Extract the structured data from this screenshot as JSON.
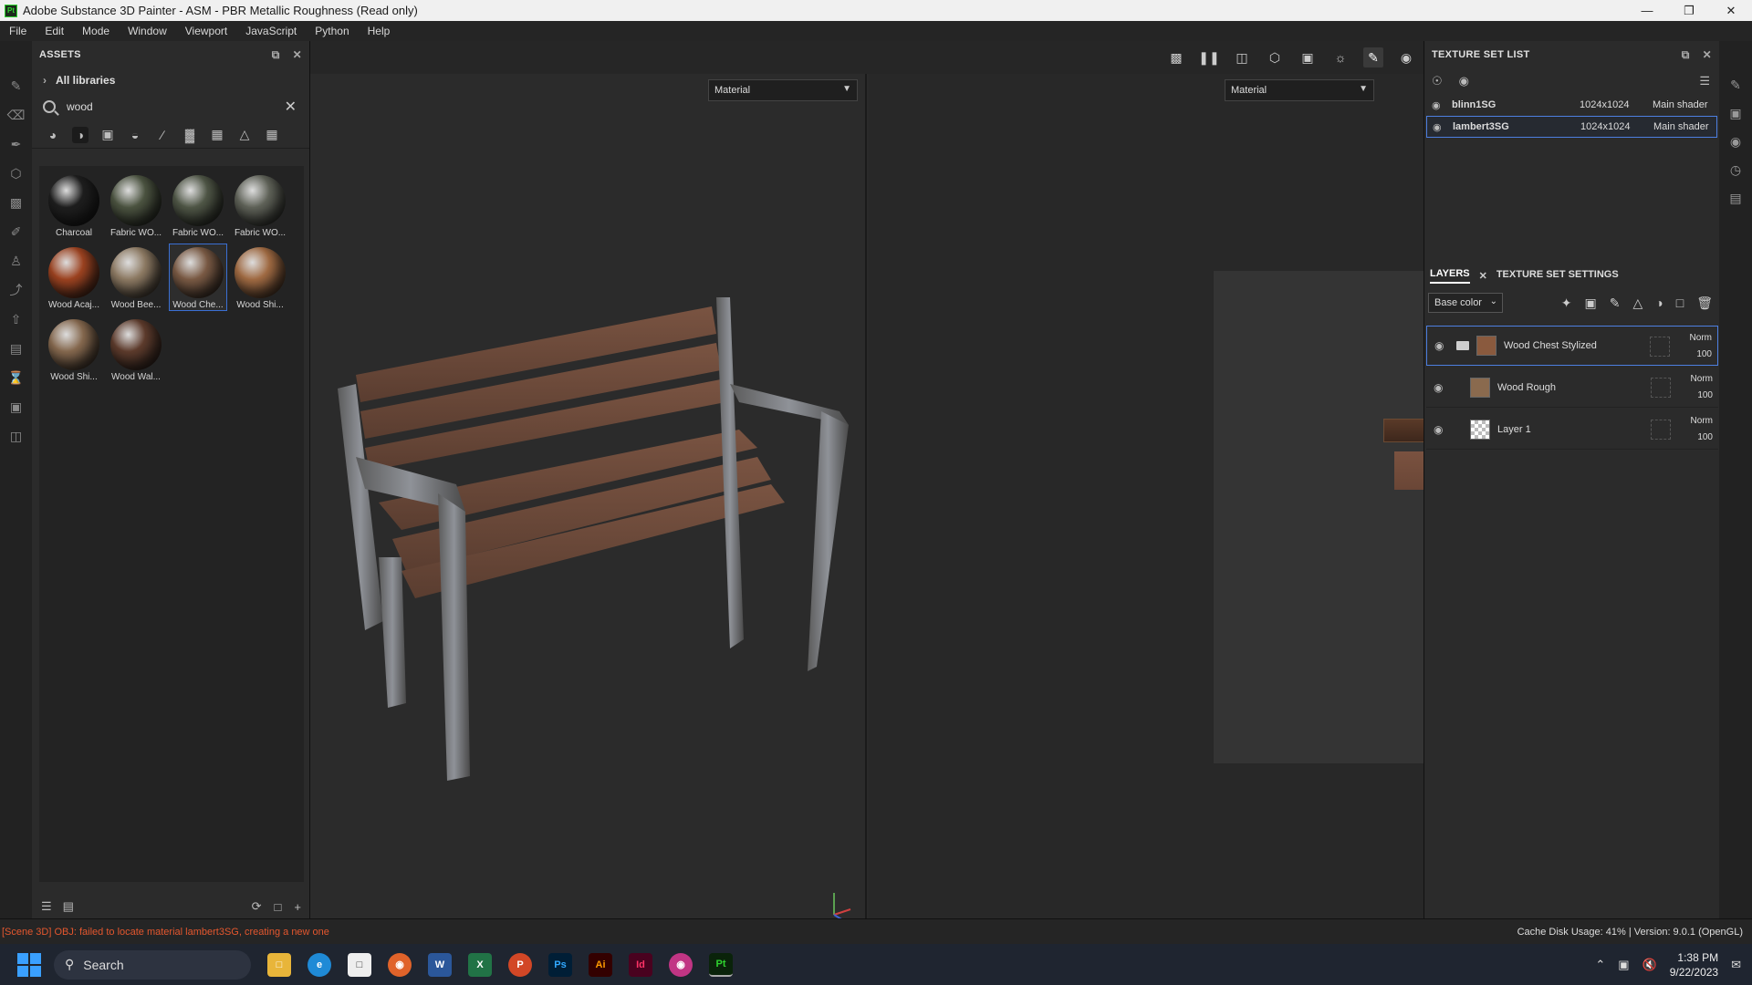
{
  "window": {
    "title": "Adobe Substance 3D Painter - ASM - PBR Metallic Roughness (Read only)",
    "app_badge": "Pt"
  },
  "menu": [
    "File",
    "Edit",
    "Mode",
    "Window",
    "Viewport",
    "JavaScript",
    "Python",
    "Help"
  ],
  "assets": {
    "title": "ASSETS",
    "library": "All libraries",
    "search_value": "wood",
    "items": [
      {
        "label": "Charcoal",
        "color": "#1e1e1e"
      },
      {
        "label": "Fabric WO...",
        "color": "#4b5340"
      },
      {
        "label": "Fabric WO...",
        "color": "#4f5646"
      },
      {
        "label": "Fabric WO...",
        "color": "#5f6258"
      },
      {
        "label": "Wood Acaj...",
        "color": "#9c4220"
      },
      {
        "label": "Wood Bee...",
        "color": "#8d7a63"
      },
      {
        "label": "Wood Che...",
        "color": "#7a5a44"
      },
      {
        "label": "Wood Shi...",
        "color": "#a06a42"
      },
      {
        "label": "Wood Shi...",
        "color": "#85684e"
      },
      {
        "label": "Wood Wal...",
        "color": "#5d3b2c"
      }
    ],
    "selected_index": 6
  },
  "viewport": {
    "left_dropdown": "Material",
    "right_dropdown": "Material"
  },
  "texture_set_list": {
    "title": "TEXTURE SET LIST",
    "rows": [
      {
        "name": "blinn1SG",
        "resolution": "1024x1024",
        "shader": "Main shader"
      },
      {
        "name": "lambert3SG",
        "resolution": "1024x1024",
        "shader": "Main shader"
      }
    ]
  },
  "layers_panel": {
    "tab_layers": "LAYERS",
    "tab_settings": "TEXTURE SET SETTINGS",
    "channel": "Base color",
    "layers": [
      {
        "name": "Wood Chest Stylized",
        "blend": "Norm",
        "opacity": "100"
      },
      {
        "name": "Wood Rough",
        "blend": "Norm",
        "opacity": "100"
      },
      {
        "name": "Layer 1",
        "blend": "Norm",
        "opacity": "100"
      }
    ]
  },
  "status": {
    "error": "[Scene 3D] OBJ: failed to locate material lambert3SG, creating a new one",
    "cache": "Cache Disk Usage:    41% | Version: 9.0.1 (OpenGL)"
  },
  "taskbar": {
    "search_placeholder": "Search",
    "time": "1:38 PM",
    "date": "9/22/2023"
  }
}
